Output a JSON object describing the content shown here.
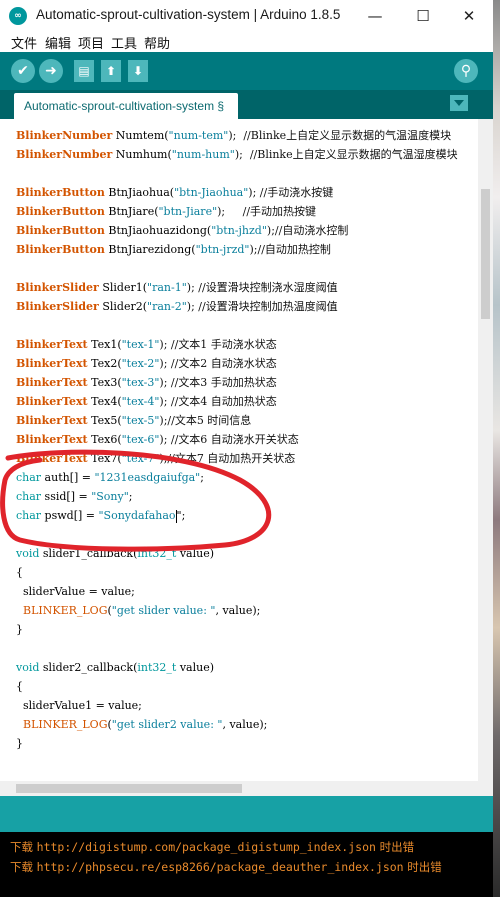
{
  "window": {
    "title": "Automatic-sprout-cultivation-system | Arduino 1.8.5",
    "icon": "arduino-icon",
    "controls": {
      "minimize": "—",
      "maximize": "☐",
      "close": "✕"
    }
  },
  "menu": [
    "文件",
    "编辑",
    "项目",
    "工具",
    "帮助"
  ],
  "toolbar": {
    "verify_icon": "✔",
    "upload_icon": "➜",
    "new_icon": "▤",
    "open_icon": "⬆",
    "save_icon": "⬇",
    "serial_monitor_icon": "⚲"
  },
  "tab": {
    "label": "Automatic-sprout-cultivation-system §"
  },
  "code": {
    "l0": {
      "type": "BlinkerNumber",
      "rest": " Numtem(",
      "str": "\"num-tem\"",
      "tail": ");  //Blinke上自定义显示数据的气温温度模块"
    },
    "l1": {
      "type": "BlinkerNumber",
      "rest": " Numhum(",
      "str": "\"num-hum\"",
      "tail": ");  //Blinke上自定义显示数据的气温湿度模块"
    },
    "l2": {
      "type": "BlinkerButton",
      "rest": " BtnJiaohua(",
      "str": "\"btn-Jiaohua\"",
      "tail": "); //手动浇水按键"
    },
    "l3": {
      "type": "BlinkerButton",
      "rest": " BtnJiare(",
      "str": "\"btn-Jiare\"",
      "tail": ");     //手动加热按键"
    },
    "l4": {
      "type": "BlinkerButton",
      "rest": " BtnJiaohuazidong(",
      "str": "\"btn-jhzd\"",
      "tail": ");//自动浇水控制"
    },
    "l5": {
      "type": "BlinkerButton",
      "rest": " BtnJiarezidong(",
      "str": "\"btn-jrzd\"",
      "tail": ");//自动加热控制"
    },
    "l6": {
      "type": "BlinkerSlider",
      "rest": " Slider1(",
      "str": "\"ran-1\"",
      "tail": "); //设置滑块控制浇水湿度阈值"
    },
    "l7": {
      "type": "BlinkerSlider",
      "rest": " Slider2(",
      "str": "\"ran-2\"",
      "tail": "); //设置滑块控制加热温度阈值"
    },
    "l8": {
      "type": "BlinkerText",
      "rest": " Tex1(",
      "str": "\"tex-1\"",
      "tail": "); //文本1 手动浇水状态"
    },
    "l9": {
      "type": "BlinkerText",
      "rest": " Tex2(",
      "str": "\"tex-2\"",
      "tail": "); //文本2 自动浇水状态"
    },
    "l10": {
      "type": "BlinkerText",
      "rest": " Tex3(",
      "str": "\"tex-3\"",
      "tail": "); //文本3 手动加热状态"
    },
    "l11": {
      "type": "BlinkerText",
      "rest": " Tex4(",
      "str": "\"tex-4\"",
      "tail": "); //文本4 自动加热状态"
    },
    "l12": {
      "type": "BlinkerText",
      "rest": " Tex5(",
      "str": "\"tex-5\"",
      "tail": ");//文本5 时间信息"
    },
    "l13": {
      "type": "BlinkerText",
      "rest": " Tex6(",
      "str": "\"tex-6\"",
      "tail": "); //文本6 自动浇水开关状态"
    },
    "l14": {
      "type": "BlinkerText",
      "rest": " Tex7(",
      "str": "\"tex-7\"",
      "tail": ");//文本7 自动加热开关状态"
    },
    "l15": {
      "type": "char",
      "rest": " auth[] = ",
      "str": "\"1231easdgaiufga\"",
      "tail": ";"
    },
    "l16": {
      "type": "char",
      "rest": " ssid[] = ",
      "str": "\"Sony\"",
      "tail": ";"
    },
    "l17": {
      "type": "char",
      "rest": " pswd[] = ",
      "str": "\"Sonydafahao",
      "tail": "\";"
    },
    "l18": {
      "type": "void",
      "rest": " slider1_callback(",
      "str": "int32_t",
      "tail": " value)"
    },
    "l19": "{",
    "l20": "  sliderValue = value;",
    "l21": {
      "fn": "  BLINKER_LOG",
      "rest": "(",
      "str": "\"get slider value: \"",
      "tail": ", value);"
    },
    "l22": "}",
    "l23": {
      "type": "void",
      "rest": " slider2_callback(",
      "str": "int32_t",
      "tail": " value)"
    },
    "l24": "{",
    "l25": "  sliderValue1 = value;",
    "l26": {
      "fn": "  BLINKER_LOG",
      "rest": "(",
      "str": "\"get slider2 value: \"",
      "tail": ", value);"
    },
    "l27": "}"
  },
  "console": {
    "line1": {
      "prefix": "下载 ",
      "url": "http://digistump.com/package_digistump_index.json",
      "suffix": " 时出错"
    },
    "line2": {
      "prefix": "下载 ",
      "url": "http://phpsecu.re/esp8266/package_deauther_index.json",
      "suffix": " 时出错"
    }
  },
  "colors": {
    "toolbar": "#00797f",
    "tabbar": "#006468",
    "accent": "#4db7bb",
    "annotation": "#e0242b",
    "console_text": "#e88a2c"
  }
}
